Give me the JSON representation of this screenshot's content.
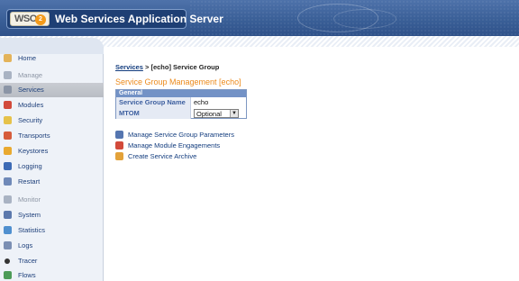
{
  "header": {
    "logo_text": "WSO",
    "logo_badge": "2",
    "app_title": "Web Services Application Server"
  },
  "sidebar": {
    "items": [
      {
        "label": "Home",
        "icon": "home-icon",
        "type": "link"
      },
      {
        "label": "Manage",
        "icon": "manage-icon",
        "type": "section"
      },
      {
        "label": "Services",
        "icon": "services-icon",
        "type": "link",
        "active": true
      },
      {
        "label": "Modules",
        "icon": "modules-icon",
        "type": "link"
      },
      {
        "label": "Security",
        "icon": "security-icon",
        "type": "link"
      },
      {
        "label": "Transports",
        "icon": "transports-icon",
        "type": "link"
      },
      {
        "label": "Keystores",
        "icon": "keystores-icon",
        "type": "link"
      },
      {
        "label": "Logging",
        "icon": "logging-icon",
        "type": "link"
      },
      {
        "label": "Restart",
        "icon": "restart-icon",
        "type": "link"
      },
      {
        "label": "Monitor",
        "icon": "monitor-icon",
        "type": "section"
      },
      {
        "label": "System",
        "icon": "system-icon",
        "type": "link"
      },
      {
        "label": "Statistics",
        "icon": "statistics-icon",
        "type": "link"
      },
      {
        "label": "Logs",
        "icon": "logs-icon",
        "type": "link"
      },
      {
        "label": "Tracer",
        "icon": "tracer-icon",
        "type": "link"
      },
      {
        "label": "Flows",
        "icon": "flows-icon",
        "type": "link"
      }
    ]
  },
  "breadcrumb": {
    "link": "Services",
    "separator": ">",
    "current": "[echo] Service Group"
  },
  "main": {
    "title": "Service Group Management [echo]",
    "panel": {
      "header": "General",
      "rows": [
        {
          "key": "Service Group Name",
          "value": "echo"
        },
        {
          "key": "MTOM",
          "value": "Optional"
        }
      ]
    },
    "links": [
      {
        "label": "Manage Service Group Parameters",
        "icon": "parameters-icon"
      },
      {
        "label": "Manage Module Engagements",
        "icon": "modules-icon"
      },
      {
        "label": "Create Service Archive",
        "icon": "archive-icon"
      }
    ]
  },
  "colors": {
    "header_blue": "#3a5f97",
    "title_orange": "#ec8a1b",
    "link_blue": "#123c7e",
    "panel_header": "#7392c6"
  }
}
